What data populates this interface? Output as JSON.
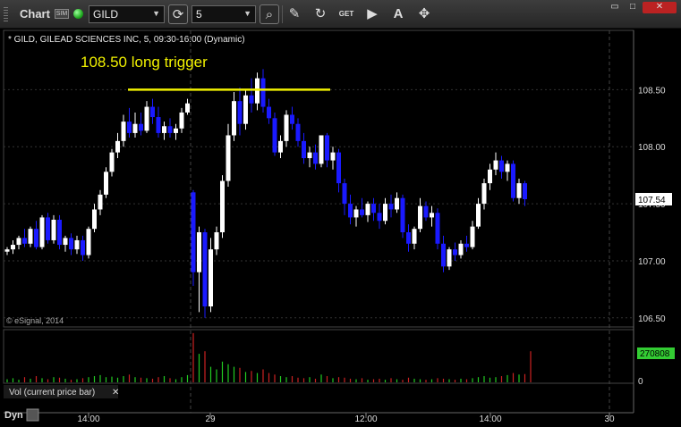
{
  "toolbar": {
    "title": "Chart",
    "sim_badge": "SIM",
    "symbol": "GILD",
    "interval": "5",
    "icons": [
      "grip-icon",
      "connection-status-icon",
      "refresh-icon",
      "search-icon",
      "pencil-icon",
      "cycle-icon",
      "get-icon",
      "play-icon",
      "text-icon",
      "crosshair-icon"
    ]
  },
  "chart_header": "* GILD, GILEAD SCIENCES INC, 5, 09:30-16:00 (Dynamic)",
  "annotation": "108.50 long trigger",
  "copyright": "© eSignal, 2014",
  "volume_label": "Vol (current price bar)",
  "dyn_label": "Dyn",
  "colors": {
    "up": "#ffffff",
    "down": "#1a1aff",
    "trigger_line": "#f0f000",
    "vol_up": "#22cc22",
    "vol_down": "#cc2222",
    "last_price_bg": "#ffffff",
    "last_volume_bg": "#33cc33"
  },
  "chart_data": {
    "type": "candlestick",
    "symbol": "GILD",
    "interval_minutes": 5,
    "y_ticks": [
      "108.50",
      "108.00",
      "107.50",
      "107.00",
      "106.50"
    ],
    "ylim": [
      106.42,
      109.02
    ],
    "x_ticks": [
      "14:00",
      "29",
      "12:00",
      "14:00",
      "30"
    ],
    "session_breaks": [
      "29",
      "30"
    ],
    "trigger_level": 108.5,
    "last_price": "107.54",
    "last_volume": "270808",
    "volume_zero_label": "0",
    "candles": [
      [
        107.08,
        107.12,
        107.05,
        107.1
      ],
      [
        107.1,
        107.18,
        107.06,
        107.14
      ],
      [
        107.14,
        107.22,
        107.1,
        107.2
      ],
      [
        107.2,
        107.28,
        107.12,
        107.15
      ],
      [
        107.15,
        107.3,
        107.12,
        107.28
      ],
      [
        107.28,
        107.35,
        107.1,
        107.12
      ],
      [
        107.12,
        107.4,
        107.1,
        107.38
      ],
      [
        107.38,
        107.42,
        107.15,
        107.18
      ],
      [
        107.18,
        107.4,
        107.15,
        107.36
      ],
      [
        107.36,
        107.4,
        107.1,
        107.14
      ],
      [
        107.14,
        107.22,
        107.08,
        107.2
      ],
      [
        107.2,
        107.24,
        107.05,
        107.1
      ],
      [
        107.1,
        107.22,
        107.06,
        107.18
      ],
      [
        107.18,
        107.22,
        107.0,
        107.05
      ],
      [
        107.05,
        107.3,
        107.02,
        107.28
      ],
      [
        107.28,
        107.5,
        107.25,
        107.45
      ],
      [
        107.45,
        107.62,
        107.4,
        107.58
      ],
      [
        107.58,
        107.82,
        107.55,
        107.78
      ],
      [
        107.78,
        107.98,
        107.74,
        107.95
      ],
      [
        107.95,
        108.12,
        107.9,
        108.05
      ],
      [
        108.05,
        108.28,
        108.0,
        108.22
      ],
      [
        108.22,
        108.34,
        108.08,
        108.12
      ],
      [
        108.12,
        108.3,
        108.08,
        108.2
      ],
      [
        108.2,
        108.3,
        108.1,
        108.14
      ],
      [
        108.14,
        108.4,
        108.12,
        108.35
      ],
      [
        108.35,
        108.42,
        108.2,
        108.26
      ],
      [
        108.26,
        108.35,
        108.08,
        108.12
      ],
      [
        108.12,
        108.22,
        108.06,
        108.18
      ],
      [
        108.18,
        108.25,
        108.08,
        108.12
      ],
      [
        108.12,
        108.2,
        108.06,
        108.16
      ],
      [
        108.16,
        108.34,
        108.12,
        108.3
      ],
      [
        108.3,
        108.42,
        108.28,
        108.38
      ],
      [
        107.6,
        107.62,
        106.78,
        106.9
      ],
      [
        106.9,
        107.3,
        106.55,
        107.25
      ],
      [
        107.25,
        107.28,
        106.5,
        106.6
      ],
      [
        106.6,
        107.2,
        106.55,
        107.1
      ],
      [
        107.1,
        107.3,
        107.05,
        107.25
      ],
      [
        107.25,
        107.75,
        107.2,
        107.7
      ],
      [
        107.7,
        108.2,
        107.65,
        108.1
      ],
      [
        108.1,
        108.48,
        108.05,
        108.4
      ],
      [
        108.4,
        108.52,
        108.1,
        108.2
      ],
      [
        108.2,
        108.5,
        108.15,
        108.45
      ],
      [
        108.45,
        108.6,
        108.3,
        108.38
      ],
      [
        108.38,
        108.65,
        108.32,
        108.6
      ],
      [
        108.6,
        108.68,
        108.3,
        108.35
      ],
      [
        108.35,
        108.42,
        108.2,
        108.25
      ],
      [
        108.25,
        108.3,
        107.92,
        107.95
      ],
      [
        107.95,
        108.1,
        107.9,
        108.05
      ],
      [
        108.05,
        108.32,
        108.0,
        108.28
      ],
      [
        108.28,
        108.35,
        108.15,
        108.2
      ],
      [
        108.2,
        108.25,
        108.0,
        108.05
      ],
      [
        108.05,
        108.12,
        107.85,
        107.9
      ],
      [
        107.9,
        108.0,
        107.82,
        107.95
      ],
      [
        107.95,
        108.02,
        107.8,
        107.85
      ],
      [
        107.85,
        108.1,
        107.82,
        108.1
      ],
      [
        108.1,
        108.12,
        107.82,
        107.88
      ],
      [
        107.88,
        108.0,
        107.8,
        107.95
      ],
      [
        107.95,
        107.98,
        107.6,
        107.68
      ],
      [
        107.68,
        107.72,
        107.4,
        107.5
      ],
      [
        107.5,
        107.58,
        107.32,
        107.38
      ],
      [
        107.38,
        107.48,
        107.3,
        107.45
      ],
      [
        107.45,
        107.55,
        107.38,
        107.4
      ],
      [
        107.4,
        107.52,
        107.34,
        107.5
      ],
      [
        107.5,
        107.55,
        107.35,
        107.42
      ],
      [
        107.42,
        107.5,
        107.28,
        107.35
      ],
      [
        107.35,
        107.55,
        107.32,
        107.5
      ],
      [
        107.5,
        107.58,
        107.38,
        107.45
      ],
      [
        107.45,
        107.6,
        107.42,
        107.55
      ],
      [
        107.55,
        107.58,
        107.2,
        107.25
      ],
      [
        107.25,
        107.32,
        107.08,
        107.15
      ],
      [
        107.15,
        107.3,
        107.1,
        107.28
      ],
      [
        107.28,
        107.55,
        107.25,
        107.48
      ],
      [
        107.48,
        107.52,
        107.35,
        107.38
      ],
      [
        107.38,
        107.48,
        107.3,
        107.42
      ],
      [
        107.42,
        107.46,
        107.1,
        107.15
      ],
      [
        107.15,
        107.22,
        106.9,
        106.95
      ],
      [
        106.95,
        107.12,
        106.92,
        107.1
      ],
      [
        107.1,
        107.16,
        107.0,
        107.05
      ],
      [
        107.05,
        107.18,
        107.02,
        107.15
      ],
      [
        107.15,
        107.22,
        107.08,
        107.12
      ],
      [
        107.12,
        107.35,
        107.1,
        107.3
      ],
      [
        107.3,
        107.55,
        107.28,
        107.5
      ],
      [
        107.5,
        107.72,
        107.45,
        107.68
      ],
      [
        107.68,
        107.85,
        107.62,
        107.8
      ],
      [
        107.8,
        107.95,
        107.75,
        107.88
      ],
      [
        107.88,
        107.92,
        107.72,
        107.78
      ],
      [
        107.78,
        107.88,
        107.7,
        107.85
      ],
      [
        107.85,
        107.88,
        107.52,
        107.55
      ],
      [
        107.55,
        107.72,
        107.5,
        107.68
      ],
      [
        107.68,
        107.7,
        107.48,
        107.54
      ]
    ],
    "volume_relative": [
      0.06,
      0.08,
      0.05,
      0.1,
      0.07,
      0.12,
      0.08,
      0.06,
      0.1,
      0.09,
      0.07,
      0.05,
      0.06,
      0.08,
      0.1,
      0.12,
      0.14,
      0.1,
      0.11,
      0.09,
      0.12,
      0.15,
      0.1,
      0.09,
      0.08,
      0.07,
      0.1,
      0.12,
      0.08,
      0.06,
      0.1,
      0.14,
      0.95,
      0.55,
      0.6,
      0.3,
      0.25,
      0.4,
      0.35,
      0.3,
      0.28,
      0.2,
      0.22,
      0.18,
      0.25,
      0.18,
      0.15,
      0.12,
      0.1,
      0.12,
      0.09,
      0.08,
      0.1,
      0.07,
      0.15,
      0.12,
      0.08,
      0.1,
      0.09,
      0.07,
      0.06,
      0.08,
      0.05,
      0.06,
      0.07,
      0.05,
      0.08,
      0.06,
      0.05,
      0.09,
      0.07,
      0.06,
      0.05,
      0.06,
      0.08,
      0.07,
      0.06,
      0.05,
      0.07,
      0.06,
      0.08,
      0.1,
      0.12,
      0.09,
      0.1,
      0.12,
      0.14,
      0.18,
      0.15,
      0.16,
      0.6
    ]
  }
}
